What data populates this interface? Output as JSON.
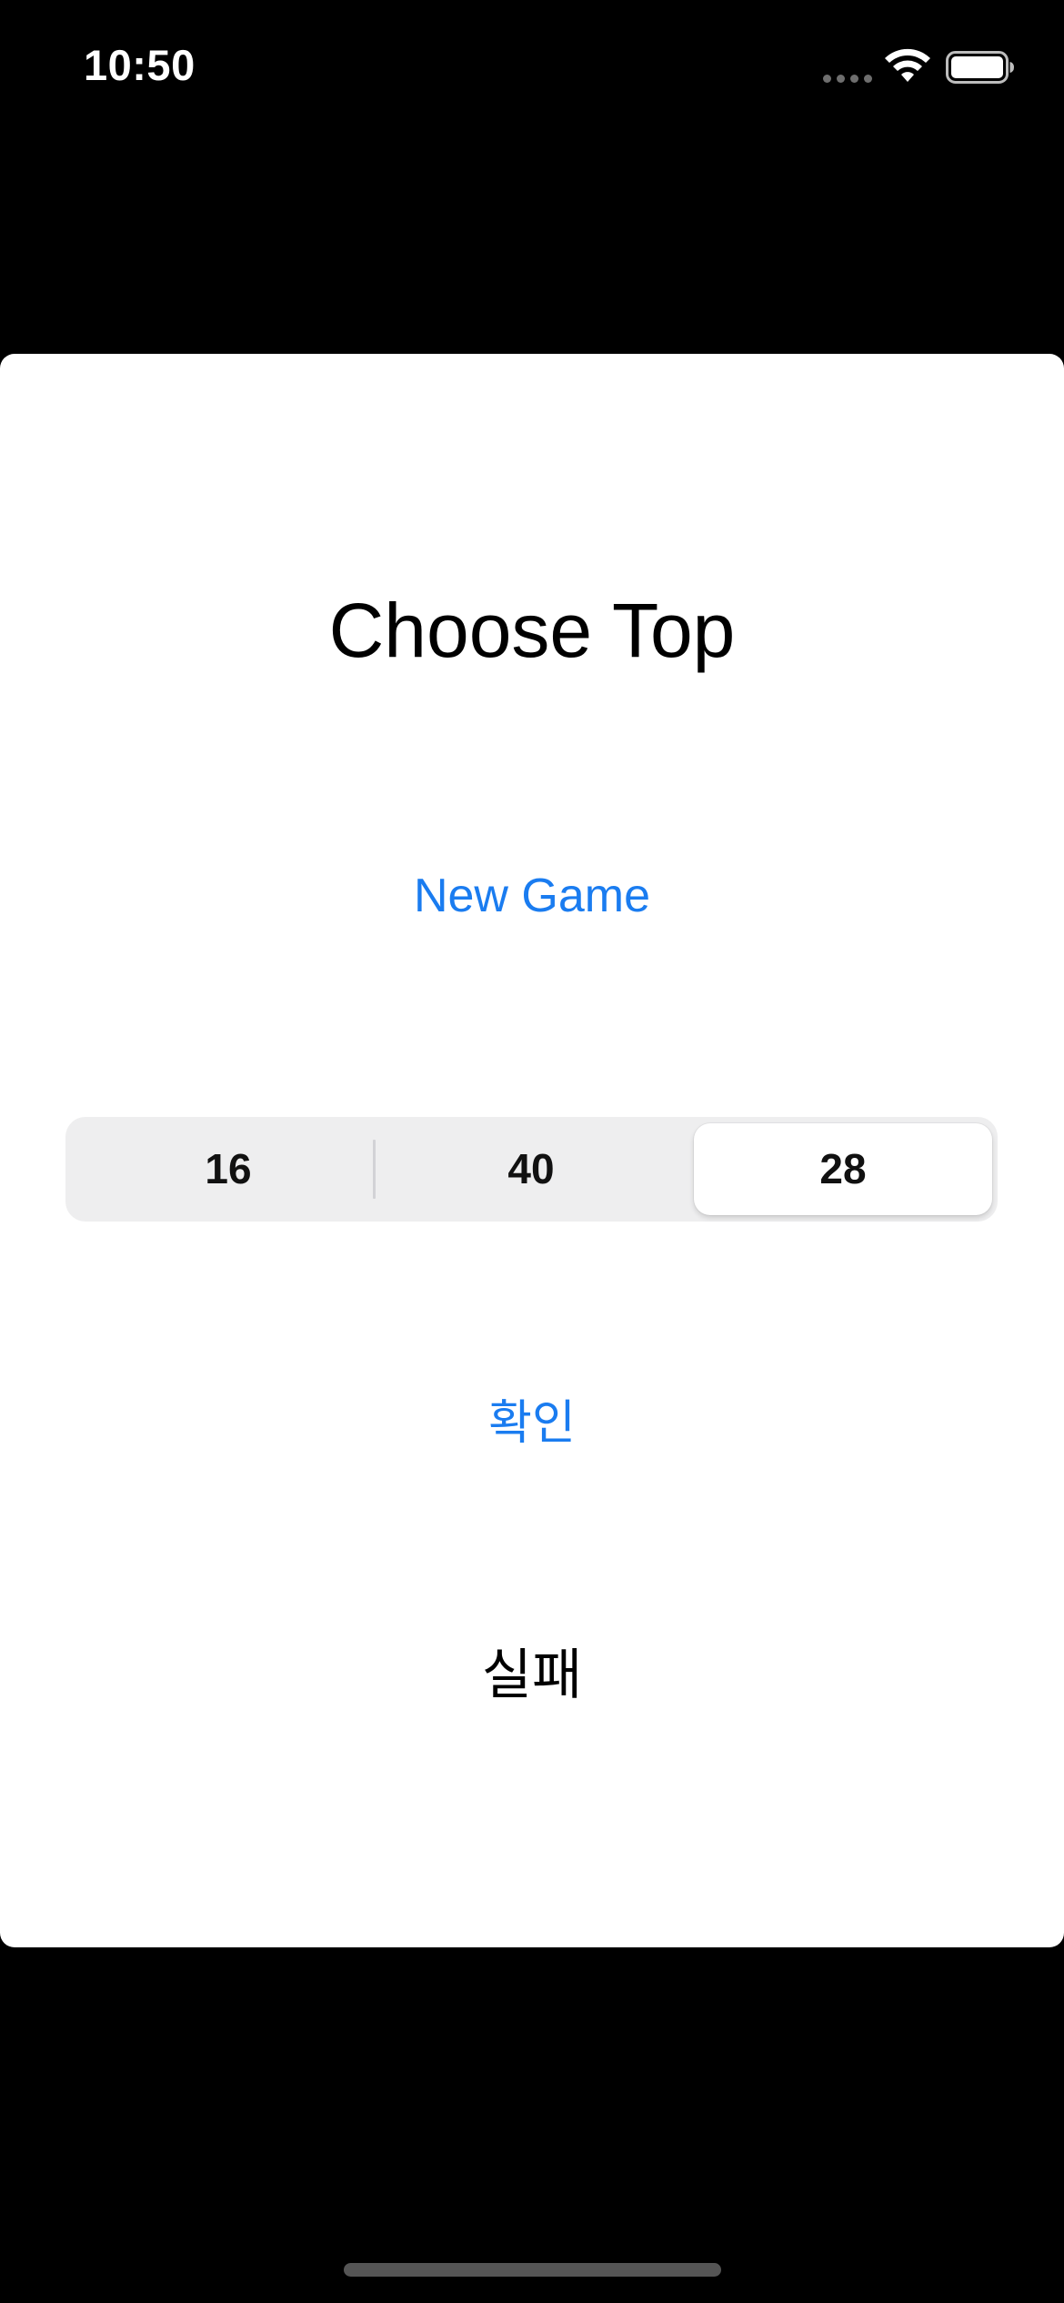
{
  "status_bar": {
    "time": "10:50"
  },
  "screen": {
    "title": "Choose Top",
    "new_game_label": "New Game",
    "segmented_control": {
      "options": [
        "16",
        "40",
        "28"
      ],
      "selected_index": 2
    },
    "confirm_label": "확인",
    "result_text": "실패"
  },
  "colors": {
    "accent": "#1a7cf0",
    "card_background": "#ffffff",
    "screen_background": "#000000",
    "segment_track": "#eeeeef"
  },
  "icons": {
    "signal": "cellular-signal-icon",
    "wifi": "wifi-icon",
    "battery": "battery-icon"
  }
}
